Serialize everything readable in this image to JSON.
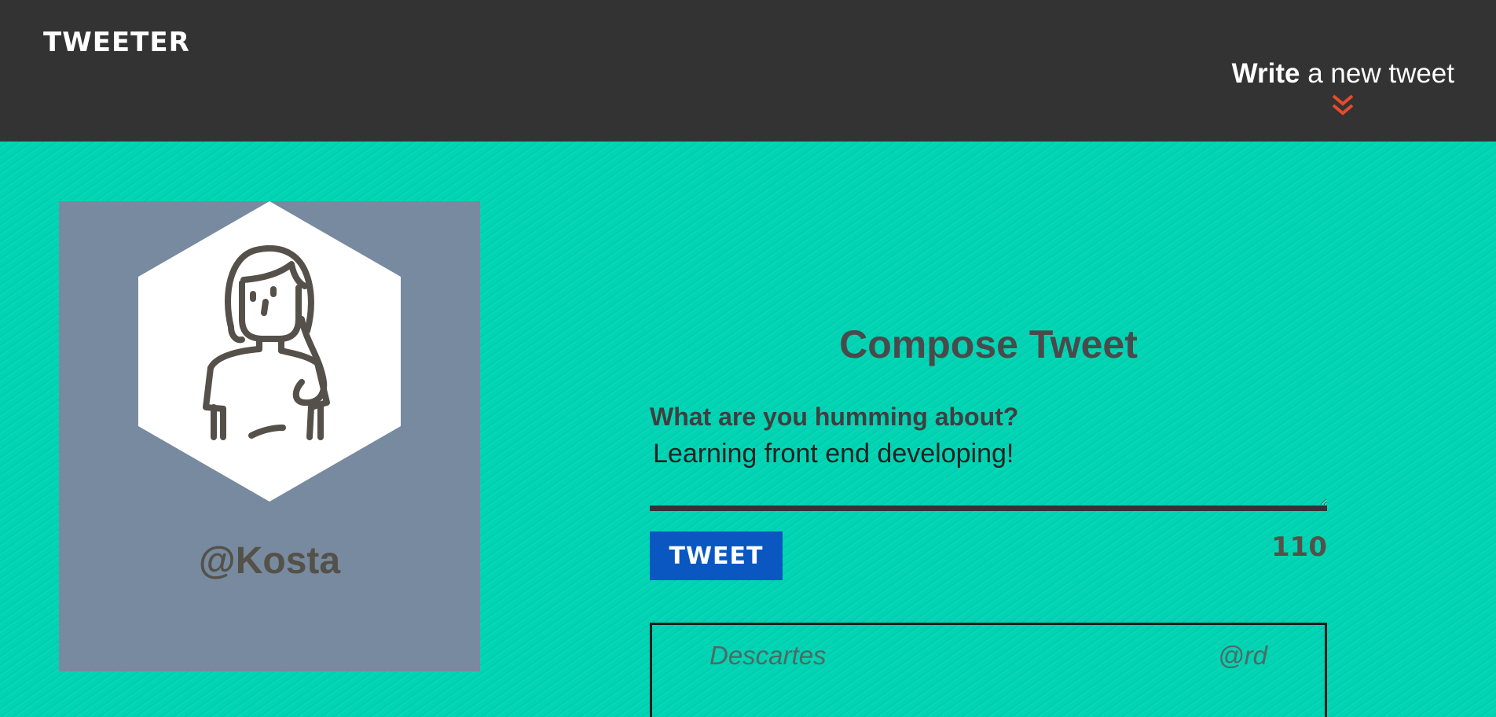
{
  "navbar": {
    "brand": "TWEETER",
    "compose_strong": "Write",
    "compose_rest": " a new tweet",
    "arrow_icon": "double-chevron-down-icon",
    "arrow_color": "#e84a2c"
  },
  "profile": {
    "avatar_icon": "user-avatar-icon",
    "handle": "@Kosta"
  },
  "compose": {
    "title": "Compose Tweet",
    "label": "What are you humming about?",
    "textarea_value": "Learning front end developing!",
    "button_label": "TWEET",
    "counter": "110"
  },
  "tweet": {
    "author": "Descartes",
    "handle": "@rd"
  },
  "colors": {
    "navbar": "#333333",
    "background": "#00d4b4",
    "card": "#778a9f",
    "button": "#0a57c2"
  }
}
